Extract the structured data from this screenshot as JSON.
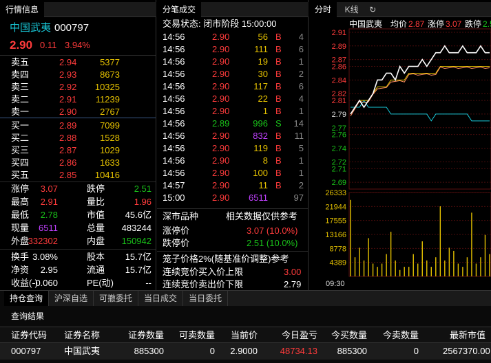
{
  "quote_panel": {
    "tab": "行情信息",
    "stock_name": "中国武夷",
    "stock_code": "000797",
    "price": "2.90",
    "change": "0.11",
    "change_pct": "3.94%",
    "asks": [
      {
        "label": "卖五",
        "price": "2.94",
        "vol": "5377"
      },
      {
        "label": "卖四",
        "price": "2.93",
        "vol": "8673"
      },
      {
        "label": "卖三",
        "price": "2.92",
        "vol": "10325"
      },
      {
        "label": "卖二",
        "price": "2.91",
        "vol": "11239"
      },
      {
        "label": "卖一",
        "price": "2.90",
        "vol": "2767"
      }
    ],
    "bids": [
      {
        "label": "买一",
        "price": "2.89",
        "vol": "7099"
      },
      {
        "label": "买二",
        "price": "2.88",
        "vol": "1528"
      },
      {
        "label": "买三",
        "price": "2.87",
        "vol": "1029"
      },
      {
        "label": "买四",
        "price": "2.86",
        "vol": "1633"
      },
      {
        "label": "买五",
        "price": "2.85",
        "vol": "10416"
      }
    ],
    "stats": [
      {
        "l1": "涨停",
        "v1": "3.07",
        "l2": "跌停",
        "v2": "2.51"
      },
      {
        "l1": "最高",
        "v1": "2.91",
        "l2": "量比",
        "v2": "1.96"
      },
      {
        "l1": "最低",
        "v1": "2.78",
        "l2": "市值",
        "v2": "45.6亿"
      },
      {
        "l1": "现量",
        "v1": "6511",
        "l2": "总量",
        "v2": "483244"
      },
      {
        "l1": "外盘",
        "v1": "332302",
        "l2": "内盘",
        "v2": "150942"
      },
      {
        "l1": "换手",
        "v1": "3.08%",
        "l2": "股本",
        "v2": "15.7亿"
      },
      {
        "l1": "净资",
        "v1": "2.95",
        "l2": "流通",
        "v2": "15.7亿"
      },
      {
        "l1": "收益(-)",
        "v1": "-0.060",
        "l2": "PE(动)",
        "v2": "--"
      }
    ]
  },
  "trades_panel": {
    "tab": "分笔成交",
    "status": "交易状态: 闭市阶段 15:00:00",
    "rows": [
      {
        "t": "14:56",
        "p": "2.90",
        "v": "56",
        "s": "B",
        "n": "4"
      },
      {
        "t": "14:56",
        "p": "2.90",
        "v": "111",
        "s": "B",
        "n": "6"
      },
      {
        "t": "14:56",
        "p": "2.90",
        "v": "19",
        "s": "B",
        "n": "1"
      },
      {
        "t": "14:56",
        "p": "2.90",
        "v": "30",
        "s": "B",
        "n": "2"
      },
      {
        "t": "14:56",
        "p": "2.90",
        "v": "117",
        "s": "B",
        "n": "6"
      },
      {
        "t": "14:56",
        "p": "2.90",
        "v": "22",
        "s": "B",
        "n": "4"
      },
      {
        "t": "14:56",
        "p": "2.90",
        "v": "1",
        "s": "B",
        "n": "1"
      },
      {
        "t": "14:56",
        "p": "2.89",
        "v": "996",
        "s": "S",
        "n": "14"
      },
      {
        "t": "14:56",
        "p": "2.90",
        "v": "832",
        "s": "B",
        "n": "11"
      },
      {
        "t": "14:56",
        "p": "2.90",
        "v": "119",
        "s": "B",
        "n": "5"
      },
      {
        "t": "14:56",
        "p": "2.90",
        "v": "8",
        "s": "B",
        "n": "1"
      },
      {
        "t": "14:56",
        "p": "2.90",
        "v": "100",
        "s": "B",
        "n": "1"
      },
      {
        "t": "14:57",
        "p": "2.90",
        "v": "11",
        "s": "B",
        "n": "2"
      },
      {
        "t": "15:00",
        "p": "2.90",
        "v": "6511",
        "s": "",
        "n": "97"
      }
    ],
    "market": {
      "title": "深市品种",
      "note": "相关数据仅供参考",
      "limit_up_label": "涨停价",
      "limit_up": "3.07 (10.0%)",
      "limit_down_label": "跌停价",
      "limit_down": "2.51 (10.0%)",
      "cage": "笼子价格2%(随基准价调整)参考",
      "buy_label": "连续竞价买入价上限",
      "buy": "3.00",
      "sell_label": "连续竞价卖出价下限",
      "sell": "2.79"
    }
  },
  "chart_panel": {
    "tabs": [
      "分时",
      "K线"
    ],
    "name": "中国武夷",
    "avg_label": "均价",
    "avg": "2.87",
    "up_label": "涨停",
    "up": "3.07",
    "down_label": "跌停",
    "down": "2.5",
    "price_ticks": [
      "2.91",
      "2.89",
      "2.87",
      "2.86",
      "2.84",
      "2.82",
      "2.81",
      "2.79",
      "2.77",
      "2.76",
      "2.74",
      "2.72",
      "2.71",
      "2.69"
    ],
    "vol_ticks": [
      "26333",
      "21944",
      "17555",
      "13166",
      "8778",
      "4389"
    ],
    "time_label": "09:30"
  },
  "chart_data": {
    "type": "line",
    "ylim": [
      2.68,
      2.915
    ],
    "prev_close": 2.79,
    "price": [
      2.79,
      2.8,
      2.81,
      2.8,
      2.81,
      2.82,
      2.84,
      2.84,
      2.85,
      2.85,
      2.84,
      2.86,
      2.85,
      2.86,
      2.86,
      2.86,
      2.87,
      2.86,
      2.87,
      2.88,
      2.88,
      2.89,
      2.88,
      2.88,
      2.88,
      2.89,
      2.88,
      2.88,
      2.88,
      2.89,
      2.88,
      2.88
    ],
    "avg": [
      2.79,
      2.8,
      2.81,
      2.81,
      2.81,
      2.82,
      2.83,
      2.83,
      2.83,
      2.84,
      2.84,
      2.84,
      2.84,
      2.85,
      2.85,
      2.85,
      2.85,
      2.85,
      2.85,
      2.85,
      2.86,
      2.86,
      2.86,
      2.86,
      2.86,
      2.86,
      2.86,
      2.86,
      2.86,
      2.86,
      2.86,
      2.86
    ],
    "index": [
      2.8,
      2.8,
      2.8,
      2.81,
      2.8,
      2.8,
      2.8,
      2.8,
      2.8,
      2.79,
      2.79,
      2.79,
      2.79,
      2.79,
      2.79,
      2.79,
      2.79,
      2.79,
      2.78,
      2.79,
      2.79,
      2.79,
      2.79,
      2.79,
      2.79,
      2.79,
      2.79,
      2.78,
      2.78,
      2.78,
      2.78,
      2.78
    ],
    "volume": [
      24000,
      6000,
      9000,
      5000,
      12000,
      4000,
      3000,
      4000,
      7000,
      14000,
      5000,
      2000,
      3000,
      3000,
      7000,
      4000,
      11000,
      5000,
      3000,
      6000,
      22000,
      5000,
      9000,
      8000,
      4000,
      3000,
      6000,
      20000,
      4000,
      6000,
      13000,
      7000
    ],
    "vol_max": 26333
  },
  "bottom": {
    "tabs": [
      "持仓查询",
      "沪深自选",
      "可撤委托",
      "当日成交",
      "当日委托"
    ],
    "result_label": "查询结果",
    "headers": [
      "证券代码",
      "证券名称",
      "证券数量",
      "可卖数量",
      "当前价",
      "今日盈亏",
      "今买数量",
      "今卖数量",
      "最新市值"
    ],
    "row": [
      "000797",
      "中国武夷",
      "885300",
      "0",
      "2.9000",
      "48734.13",
      "885300",
      "0",
      "2567370.00"
    ]
  },
  "colors": {
    "up": "#ff3b3b",
    "down": "#19c219",
    "volume": "#e6c200",
    "bg": "#000000"
  }
}
